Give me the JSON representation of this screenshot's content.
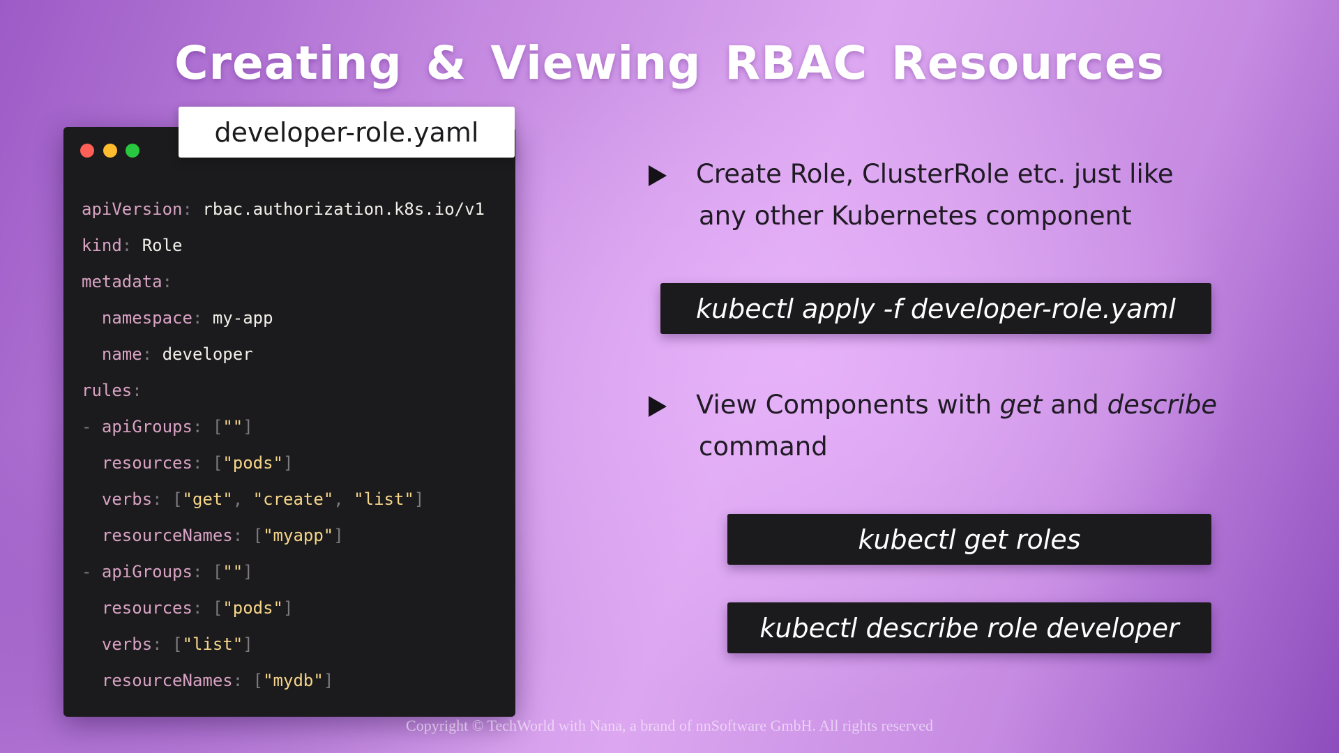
{
  "slide": {
    "title": "Creating  & Viewing  RBAC Resources",
    "copyright": "Copyright © TechWorld with Nana, a brand of nnSoftware GmbH. All rights reserved"
  },
  "editor": {
    "file_name": "developer-role.yaml",
    "window_buttons": [
      "close",
      "minimize",
      "maximize"
    ],
    "lines": [
      {
        "indent": "",
        "dash": "",
        "key": "apiVersion",
        "value": "rbac.authorization.k8s.io/v1",
        "type": "scalar"
      },
      {
        "indent": "",
        "dash": "",
        "key": "kind",
        "value": "Role",
        "type": "scalar"
      },
      {
        "indent": "",
        "dash": "",
        "key": "metadata",
        "value": "",
        "type": "scalar"
      },
      {
        "indent": "  ",
        "dash": "",
        "key": "namespace",
        "value": "my-app",
        "type": "scalar"
      },
      {
        "indent": "  ",
        "dash": "",
        "key": "name",
        "value": "developer",
        "type": "scalar"
      },
      {
        "indent": "",
        "dash": "",
        "key": "rules",
        "value": "",
        "type": "scalar"
      },
      {
        "indent": "",
        "dash": "- ",
        "key": "apiGroups",
        "items": [
          "\"\""
        ],
        "type": "list"
      },
      {
        "indent": "  ",
        "dash": "",
        "key": "resources",
        "items": [
          "\"pods\""
        ],
        "type": "list"
      },
      {
        "indent": "  ",
        "dash": "",
        "key": "verbs",
        "items": [
          "\"get\"",
          "\"create\"",
          "\"list\""
        ],
        "type": "list"
      },
      {
        "indent": "  ",
        "dash": "",
        "key": "resourceNames",
        "items": [
          "\"myapp\""
        ],
        "type": "list"
      },
      {
        "indent": "",
        "dash": "- ",
        "key": "apiGroups",
        "items": [
          "\"\""
        ],
        "type": "list"
      },
      {
        "indent": "  ",
        "dash": "",
        "key": "resources",
        "items": [
          "\"pods\""
        ],
        "type": "list"
      },
      {
        "indent": "  ",
        "dash": "",
        "key": "verbs",
        "items": [
          "\"list\""
        ],
        "type": "list"
      },
      {
        "indent": "  ",
        "dash": "",
        "key": "resourceNames",
        "items": [
          "\"mydb\""
        ],
        "type": "list"
      }
    ]
  },
  "bullets": [
    {
      "line1": "Create Role, ClusterRole etc. just like",
      "line2": "any other Kubernetes component"
    },
    {
      "prefix": "View Components with ",
      "em1": "get",
      "middle": " and ",
      "em2": "describe",
      "line2": "command"
    }
  ],
  "commands": {
    "apply": "kubectl apply -f developer-role.yaml",
    "get": "kubectl get roles",
    "describe": "kubectl describe role developer"
  },
  "colors": {
    "editor_bg": "#1b1a1c",
    "yaml_key": "#d8a3c4",
    "yaml_string": "#f6d68a",
    "yaml_value": "#f2f0ea",
    "yaml_punct": "#7e7a80",
    "close": "#fe5f57",
    "minimize": "#febc2e",
    "maximize": "#28c840"
  }
}
